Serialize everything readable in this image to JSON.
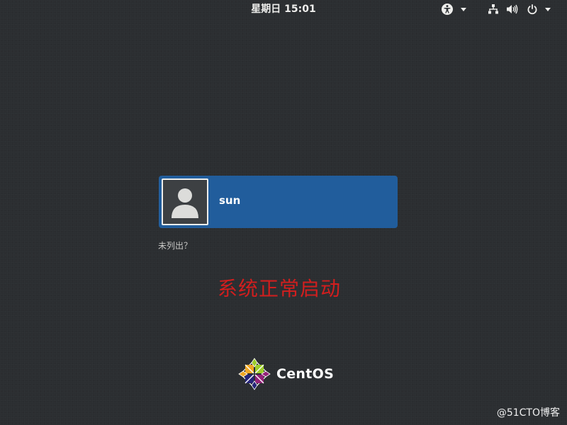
{
  "topbar": {
    "clock": "星期日 15:01",
    "icons": {
      "accessibility": "accessibility-icon",
      "network": "network-wired-icon",
      "volume": "volume-icon",
      "power": "power-icon"
    }
  },
  "login": {
    "user_name": "sun",
    "not_listed": "未列出？"
  },
  "annotation": "系统正常启动",
  "branding": {
    "os_name": "CentOS"
  },
  "watermark": "@51CTO博客",
  "colors": {
    "background": "#2b2e31",
    "user_card": "#215d9c",
    "annotation": "#d21e1e"
  }
}
